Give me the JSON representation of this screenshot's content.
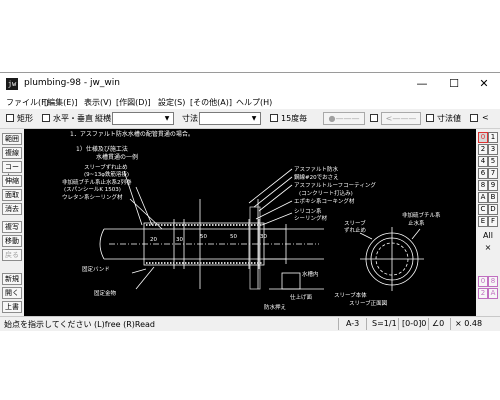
{
  "window": {
    "title": "plumbing-98 - jw_win",
    "icon_text": "jw"
  },
  "window_controls": {
    "minimize": "—",
    "maximize": "☐",
    "close": "✕"
  },
  "menu": [
    "ファイル(F)",
    "[編集(E)]",
    "表示(V)",
    "[作図(D)]",
    "設定(S)",
    "[その他(A)]",
    "ヘルプ(H)"
  ],
  "toolbar": {
    "rect_label": "矩形",
    "hv_label": "水平・垂直",
    "ratio_label": "縦横",
    "dim_label": "寸法",
    "deg15_label": "15度毎",
    "btn_circle": "●———",
    "btn_arrow": "<———",
    "dimvalue_label": "寸法値",
    "last_label": "<"
  },
  "left_tools": [
    "範囲",
    "複線",
    "コーナー",
    "伸縮",
    "面取",
    "消去",
    "複写",
    "移動",
    "戻る",
    "新規",
    "開く",
    "上書"
  ],
  "right_layers": {
    "col1": [
      "0",
      "2",
      "4",
      "6",
      "8",
      "A",
      "C",
      "E"
    ],
    "col2": [
      "1",
      "3",
      "5",
      "7",
      "9",
      "B",
      "D",
      "F"
    ],
    "all_label": "All",
    "x_label": "×",
    "group_col1": [
      "0",
      "2"
    ],
    "group_col2": [
      "8",
      "A"
    ]
  },
  "drawing": {
    "heading": "1．アスファルト防水水槽の配管貫通の場合。",
    "subheading": "1）仕様及び施工法",
    "subheading2": "水槽貫通の一例",
    "labels_left": [
      "スリーブずれ止め",
      "(9~13φ鉄筋溶接)",
      "非加硫ブチル系止水系2列巻",
      "(スパンシールK 1503)",
      "ウレタン系シーリング材"
    ],
    "labels_right": [
      "アスファルト防水",
      "鋼線#20でおさえ",
      "アスファルトルーフコーティング",
      "(コンクリート打込み)",
      "エポキシ系コーキング材",
      "シリコン系",
      "シーリング材"
    ],
    "labels_detail": [
      "スリーブ",
      "ずれ止め",
      "非加硫ブチル系",
      "止水系"
    ],
    "labels_bottom": [
      "固定バンド",
      "固定金物",
      "水槽内",
      "仕上げ面",
      "防水押え",
      "スリーブ本体",
      "スリーブ正面図"
    ],
    "dims": [
      "20",
      "30",
      "50",
      "50",
      "30"
    ]
  },
  "status": {
    "prompt": "始点を指示してください (L)free (R)Read",
    "paper": "A-3",
    "scale": "S=1/1",
    "layer": "[0-0]0",
    "angle": "∠0",
    "zoom": "× 0.48"
  }
}
